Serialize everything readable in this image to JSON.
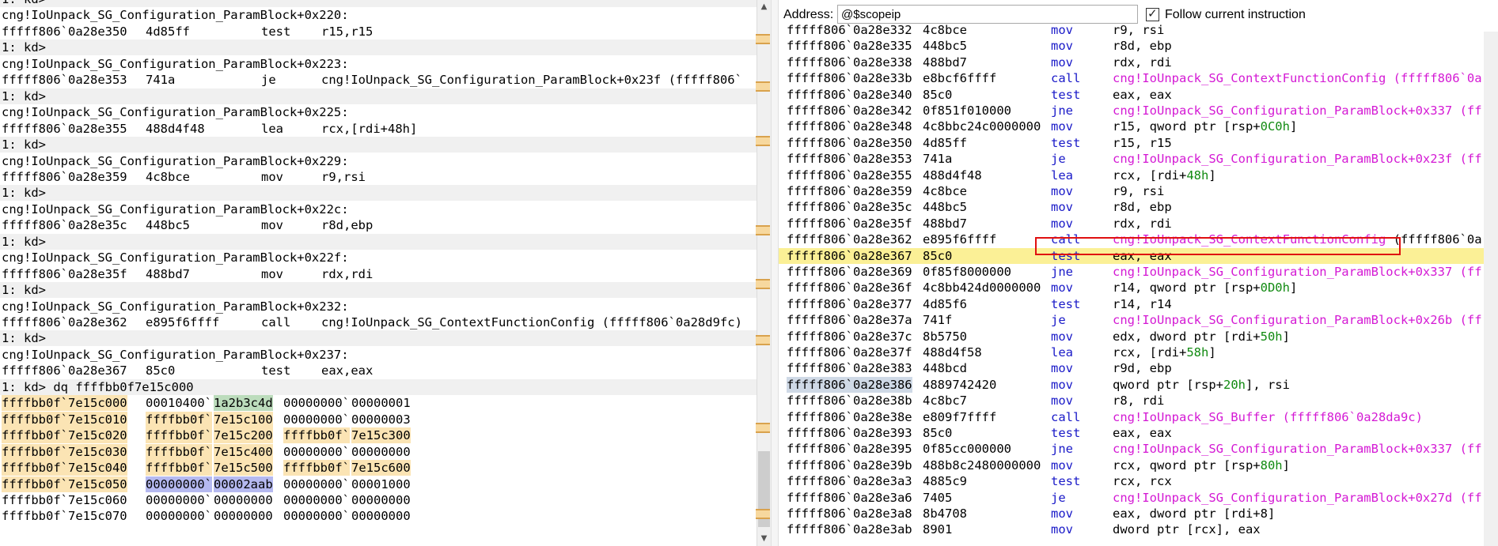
{
  "left_scroll": {
    "up_arrow": "▲",
    "down_arrow": "▼"
  },
  "commands": [
    {
      "type": "prompt",
      "text": "1: kd>"
    },
    {
      "type": "label",
      "text": "cng!IoUnpack_SG_Configuration_ParamBlock+0x220:"
    },
    {
      "type": "instr",
      "addr": "fffff806`0a28e350",
      "bytes": "4d85ff",
      "mn": "test",
      "ops": "r15,r15"
    },
    {
      "type": "prompt",
      "text": "1: kd>"
    },
    {
      "type": "label",
      "text": "cng!IoUnpack_SG_Configuration_ParamBlock+0x223:"
    },
    {
      "type": "instr",
      "addr": "fffff806`0a28e353",
      "bytes": "741a",
      "mn": "je",
      "ops": "cng!IoUnpack_SG_Configuration_ParamBlock+0x23f (fffff806`"
    },
    {
      "type": "prompt",
      "text": "1: kd>"
    },
    {
      "type": "label",
      "text": "cng!IoUnpack_SG_Configuration_ParamBlock+0x225:"
    },
    {
      "type": "instr",
      "addr": "fffff806`0a28e355",
      "bytes": "488d4f48",
      "mn": "lea",
      "ops": "rcx,[rdi+48h]"
    },
    {
      "type": "prompt",
      "text": "1: kd>"
    },
    {
      "type": "label",
      "text": "cng!IoUnpack_SG_Configuration_ParamBlock+0x229:"
    },
    {
      "type": "instr",
      "addr": "fffff806`0a28e359",
      "bytes": "4c8bce",
      "mn": "mov",
      "ops": "r9,rsi"
    },
    {
      "type": "prompt",
      "text": "1: kd>"
    },
    {
      "type": "label",
      "text": "cng!IoUnpack_SG_Configuration_ParamBlock+0x22c:"
    },
    {
      "type": "instr",
      "addr": "fffff806`0a28e35c",
      "bytes": "448bc5",
      "mn": "mov",
      "ops": "r8d,ebp"
    },
    {
      "type": "prompt",
      "text": "1: kd>"
    },
    {
      "type": "label",
      "text": "cng!IoUnpack_SG_Configuration_ParamBlock+0x22f:"
    },
    {
      "type": "instr",
      "addr": "fffff806`0a28e35f",
      "bytes": "488bd7",
      "mn": "mov",
      "ops": "rdx,rdi"
    },
    {
      "type": "prompt",
      "text": "1: kd>"
    },
    {
      "type": "label",
      "text": "cng!IoUnpack_SG_Configuration_ParamBlock+0x232:"
    },
    {
      "type": "instr",
      "addr": "fffff806`0a28e362",
      "bytes": "e895f6ffff",
      "mn": "call",
      "ops": "cng!IoUnpack_SG_ContextFunctionConfig (fffff806`0a28d9fc)"
    },
    {
      "type": "prompt",
      "text": "1: kd>"
    },
    {
      "type": "label",
      "text": "cng!IoUnpack_SG_Configuration_ParamBlock+0x237:"
    },
    {
      "type": "instr",
      "addr": "fffff806`0a28e367",
      "bytes": "85c0",
      "mn": "test",
      "ops": "eax,eax"
    },
    {
      "type": "prompt",
      "text": "1: kd> dq ffffbb0f7e15c000"
    }
  ],
  "memory": [
    {
      "addr": "ffffbb0f`7e15c000",
      "q1a": "00010400",
      "q1b": "1a2b3c4d",
      "q2a": "00000000",
      "q2b": "00000001",
      "hl": "green"
    },
    {
      "addr": "ffffbb0f`7e15c010",
      "q1a": "ffffbb0f",
      "q1b": "7e15c100",
      "q2a": "00000000",
      "q2b": "00000003",
      "hl": "q1"
    },
    {
      "addr": "ffffbb0f`7e15c020",
      "q1a": "ffffbb0f",
      "q1b": "7e15c200",
      "q2a": "ffffbb0f",
      "q2b": "7e15c300",
      "hl": "q1q2"
    },
    {
      "addr": "ffffbb0f`7e15c030",
      "q1a": "ffffbb0f",
      "q1b": "7e15c400",
      "q2a": "00000000",
      "q2b": "00000000",
      "hl": "q1"
    },
    {
      "addr": "ffffbb0f`7e15c040",
      "q1a": "ffffbb0f",
      "q1b": "7e15c500",
      "q2a": "ffffbb0f",
      "q2b": "7e15c600",
      "hl": "q1q2"
    },
    {
      "addr": "ffffbb0f`7e15c050",
      "q1a": "00000000",
      "q1b": "00002aab",
      "q2a": "00000000",
      "q2b": "00001000",
      "hl": "blue"
    },
    {
      "addr": "ffffbb0f`7e15c060",
      "q1a": "00000000",
      "q1b": "00000000",
      "q2a": "00000000",
      "q2b": "00000000",
      "hl": "none"
    },
    {
      "addr": "ffffbb0f`7e15c070",
      "q1a": "00000000",
      "q1b": "00000000",
      "q2a": "00000000",
      "q2b": "00000000",
      "hl": "none"
    }
  ],
  "disasm_header": {
    "address_label": "Address:",
    "address_value": "@$scopeip",
    "follow_label": "Follow current instruction"
  },
  "disasm": [
    {
      "addr": "fffff806`0a28e332",
      "bytes": "4c8bce",
      "mn": "mov",
      "ops": [
        [
          "t",
          "r9, rsi"
        ]
      ]
    },
    {
      "addr": "fffff806`0a28e335",
      "bytes": "448bc5",
      "mn": "mov",
      "ops": [
        [
          "t",
          "r8d, ebp"
        ]
      ]
    },
    {
      "addr": "fffff806`0a28e338",
      "bytes": "488bd7",
      "mn": "mov",
      "ops": [
        [
          "t",
          "rdx, rdi"
        ]
      ]
    },
    {
      "addr": "fffff806`0a28e33b",
      "bytes": "e8bcf6ffff",
      "mn": "call",
      "ops": [
        [
          "s",
          "cng!IoUnpack_SG_ContextFunctionConfig (fffff806`0a"
        ]
      ]
    },
    {
      "addr": "fffff806`0a28e340",
      "bytes": "85c0",
      "mn": "test",
      "ops": [
        [
          "t",
          "eax, eax"
        ]
      ]
    },
    {
      "addr": "fffff806`0a28e342",
      "bytes": "0f851f010000",
      "mn": "jne",
      "ops": [
        [
          "s",
          "cng!IoUnpack_SG_Configuration_ParamBlock+0x337 (ff"
        ]
      ]
    },
    {
      "addr": "fffff806`0a28e348",
      "bytes": "4c8bbc24c0000000",
      "mn": "mov",
      "ops": [
        [
          "t",
          "r15, qword ptr [rsp+"
        ],
        [
          "n",
          "0C0h"
        ],
        [
          "t",
          "]"
        ]
      ]
    },
    {
      "addr": "fffff806`0a28e350",
      "bytes": "4d85ff",
      "mn": "test",
      "ops": [
        [
          "t",
          "r15, r15"
        ]
      ]
    },
    {
      "addr": "fffff806`0a28e353",
      "bytes": "741a",
      "mn": "je",
      "ops": [
        [
          "s",
          "cng!IoUnpack_SG_Configuration_ParamBlock+0x23f (ff"
        ]
      ]
    },
    {
      "addr": "fffff806`0a28e355",
      "bytes": "488d4f48",
      "mn": "lea",
      "ops": [
        [
          "t",
          "rcx, [rdi+"
        ],
        [
          "n",
          "48h"
        ],
        [
          "t",
          "]"
        ]
      ]
    },
    {
      "addr": "fffff806`0a28e359",
      "bytes": "4c8bce",
      "mn": "mov",
      "ops": [
        [
          "t",
          "r9, rsi"
        ]
      ]
    },
    {
      "addr": "fffff806`0a28e35c",
      "bytes": "448bc5",
      "mn": "mov",
      "ops": [
        [
          "t",
          "r8d, ebp"
        ]
      ]
    },
    {
      "addr": "fffff806`0a28e35f",
      "bytes": "488bd7",
      "mn": "mov",
      "ops": [
        [
          "t",
          "rdx, rdi"
        ]
      ]
    },
    {
      "addr": "fffff806`0a28e362",
      "bytes": "e895f6ffff",
      "mn": "call",
      "ops": [
        [
          "s",
          "cng!IoUnpack_SG_ContextFunctionConfig"
        ],
        [
          "t",
          " (fffff806`0a"
        ]
      ],
      "boxed": true
    },
    {
      "addr": "fffff806`0a28e367",
      "bytes": "85c0",
      "mn": "test",
      "ops": [
        [
          "t",
          "eax, eax"
        ]
      ],
      "current": true
    },
    {
      "addr": "fffff806`0a28e369",
      "bytes": "0f85f8000000",
      "mn": "jne",
      "ops": [
        [
          "s",
          "cng!IoUnpack_SG_Configuration_ParamBlock+0x337 (ff"
        ]
      ]
    },
    {
      "addr": "fffff806`0a28e36f",
      "bytes": "4c8bb424d0000000",
      "mn": "mov",
      "ops": [
        [
          "t",
          "r14, qword ptr [rsp+"
        ],
        [
          "n",
          "0D0h"
        ],
        [
          "t",
          "]"
        ]
      ]
    },
    {
      "addr": "fffff806`0a28e377",
      "bytes": "4d85f6",
      "mn": "test",
      "ops": [
        [
          "t",
          "r14, r14"
        ]
      ]
    },
    {
      "addr": "fffff806`0a28e37a",
      "bytes": "741f",
      "mn": "je",
      "ops": [
        [
          "s",
          "cng!IoUnpack_SG_Configuration_ParamBlock+0x26b (ff"
        ]
      ]
    },
    {
      "addr": "fffff806`0a28e37c",
      "bytes": "8b5750",
      "mn": "mov",
      "ops": [
        [
          "t",
          "edx, dword ptr [rdi+"
        ],
        [
          "n",
          "50h"
        ],
        [
          "t",
          "]"
        ]
      ]
    },
    {
      "addr": "fffff806`0a28e37f",
      "bytes": "488d4f58",
      "mn": "lea",
      "ops": [
        [
          "t",
          "rcx, [rdi+"
        ],
        [
          "n",
          "58h"
        ],
        [
          "t",
          "]"
        ]
      ]
    },
    {
      "addr": "fffff806`0a28e383",
      "bytes": "448bcd",
      "mn": "mov",
      "ops": [
        [
          "t",
          "r9d, ebp"
        ]
      ]
    },
    {
      "addr": "fffff806`0a28e386",
      "bytes": "4889742420",
      "mn": "mov",
      "ops": [
        [
          "t",
          "qword ptr [rsp+"
        ],
        [
          "n",
          "20h"
        ],
        [
          "t",
          "], rsi"
        ]
      ],
      "addr_hl": true
    },
    {
      "addr": "fffff806`0a28e38b",
      "bytes": "4c8bc7",
      "mn": "mov",
      "ops": [
        [
          "t",
          "r8, rdi"
        ]
      ]
    },
    {
      "addr": "fffff806`0a28e38e",
      "bytes": "e809f7ffff",
      "mn": "call",
      "ops": [
        [
          "s",
          "cng!IoUnpack_SG_Buffer (fffff806`0a28da9c)"
        ]
      ]
    },
    {
      "addr": "fffff806`0a28e393",
      "bytes": "85c0",
      "mn": "test",
      "ops": [
        [
          "t",
          "eax, eax"
        ]
      ]
    },
    {
      "addr": "fffff806`0a28e395",
      "bytes": "0f85cc000000",
      "mn": "jne",
      "ops": [
        [
          "s",
          "cng!IoUnpack_SG_Configuration_ParamBlock+0x337 (ff"
        ]
      ]
    },
    {
      "addr": "fffff806`0a28e39b",
      "bytes": "488b8c2480000000",
      "mn": "mov",
      "ops": [
        [
          "t",
          "rcx, qword ptr [rsp+"
        ],
        [
          "n",
          "80h"
        ],
        [
          "t",
          "]"
        ]
      ]
    },
    {
      "addr": "fffff806`0a28e3a3",
      "bytes": "4885c9",
      "mn": "test",
      "ops": [
        [
          "t",
          "rcx, rcx"
        ]
      ]
    },
    {
      "addr": "fffff806`0a28e3a6",
      "bytes": "7405",
      "mn": "je",
      "ops": [
        [
          "s",
          "cng!IoUnpack_SG_Configuration_ParamBlock+0x27d (ff"
        ]
      ]
    },
    {
      "addr": "fffff806`0a28e3a8",
      "bytes": "8b4708",
      "mn": "mov",
      "ops": [
        [
          "t",
          "eax, dword ptr [rdi+8]"
        ]
      ]
    },
    {
      "addr": "fffff806`0a28e3ab",
      "bytes": "8901",
      "mn": "mov",
      "ops": [
        [
          "t",
          "dword ptr [rcx], eax"
        ]
      ]
    }
  ],
  "colors": {
    "mnemonic": "#1919c8",
    "symbol": "#d419d4",
    "number": "#118a11",
    "current_line": "#fbf096",
    "highlight_box": "#e01010"
  }
}
